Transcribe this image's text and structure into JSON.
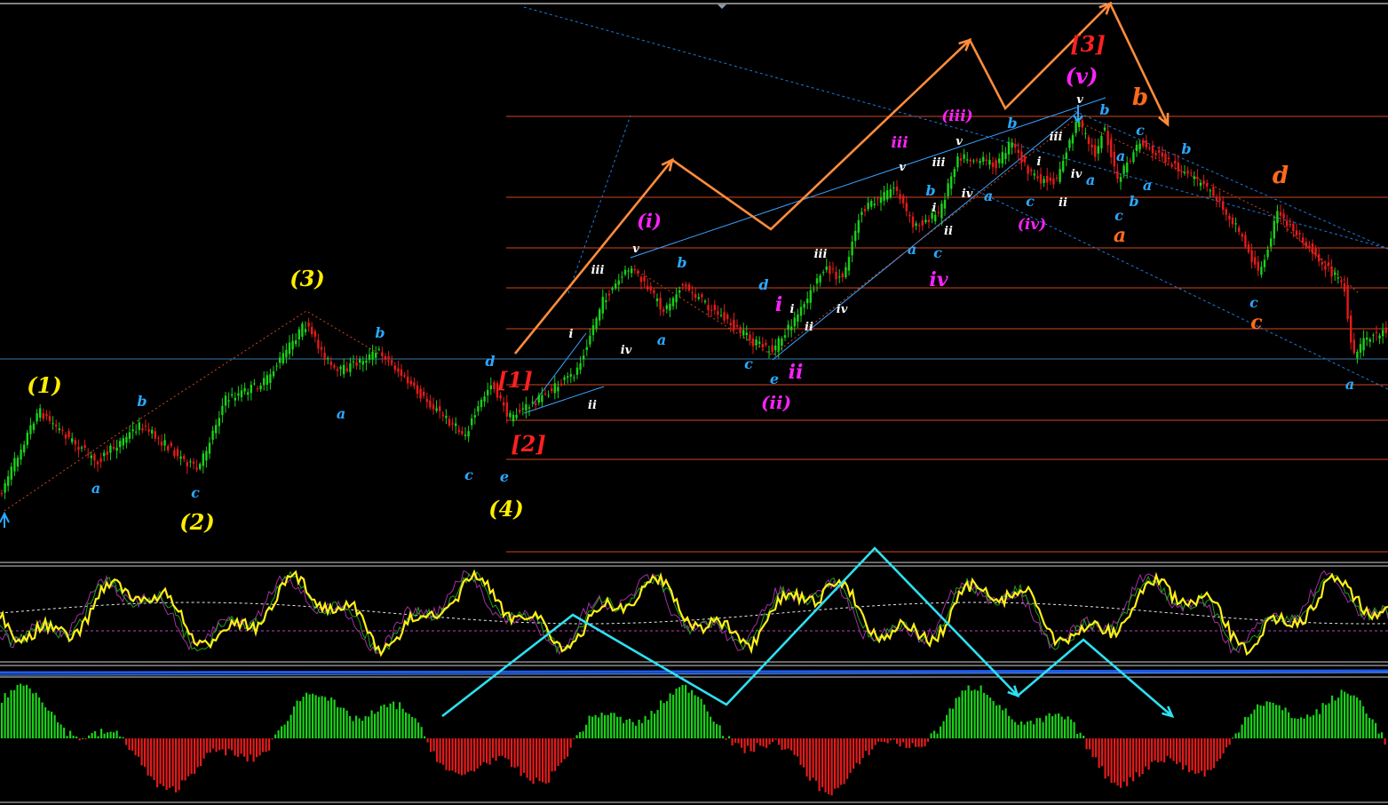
{
  "chart_data": {
    "type": "candlestick",
    "title": "",
    "xlabel": "",
    "ylabel": "",
    "grid": false,
    "indicators": [
      "oscillator",
      "histogram"
    ],
    "colors": {
      "background": "#000000",
      "bull": "#19d219",
      "bear": "#e51a1a",
      "level_line": "#d2461e",
      "trend_line": "#1e78dc",
      "orange_path": "#ff8c3c",
      "cyan_path": "#2ee0f0",
      "oscillator": "#ffef1a",
      "hist_up": "#19d219",
      "hist_down": "#e51a1a"
    },
    "wave_labels": [
      {
        "text": "(1)",
        "color": "#ffee00"
      },
      {
        "text": "(2)",
        "color": "#ffee00"
      },
      {
        "text": "(3)",
        "color": "#ffee00"
      },
      {
        "text": "(4)",
        "color": "#ffee00"
      },
      {
        "text": "a",
        "color": "#2aa8ff"
      },
      {
        "text": "b",
        "color": "#2aa8ff"
      },
      {
        "text": "c",
        "color": "#2aa8ff"
      },
      {
        "text": "a",
        "color": "#2aa8ff"
      },
      {
        "text": "b",
        "color": "#2aa8ff"
      },
      {
        "text": "c",
        "color": "#2aa8ff"
      },
      {
        "text": "d",
        "color": "#2aa8ff"
      },
      {
        "text": "e",
        "color": "#2aa8ff"
      },
      {
        "text": "[1]",
        "color": "#ff2020"
      },
      {
        "text": "[2]",
        "color": "#ff2020"
      },
      {
        "text": "[3]",
        "color": "#ff2020"
      },
      {
        "text": "i",
        "color": "#ffffff"
      },
      {
        "text": "ii",
        "color": "#ffffff"
      },
      {
        "text": "iii",
        "color": "#ffffff"
      },
      {
        "text": "iv",
        "color": "#ffffff"
      },
      {
        "text": "v",
        "color": "#ffffff"
      },
      {
        "text": "(i)",
        "color": "#ff22ff"
      },
      {
        "text": "a",
        "color": "#2aa8ff"
      },
      {
        "text": "b",
        "color": "#2aa8ff"
      },
      {
        "text": "c",
        "color": "#2aa8ff"
      },
      {
        "text": "d",
        "color": "#2aa8ff"
      },
      {
        "text": "e",
        "color": "#2aa8ff"
      },
      {
        "text": "(ii)",
        "color": "#ff22ff"
      },
      {
        "text": "i",
        "color": "#ff22ff"
      },
      {
        "text": "ii",
        "color": "#ff22ff"
      },
      {
        "text": "i",
        "color": "#ffffff"
      },
      {
        "text": "ii",
        "color": "#ffffff"
      },
      {
        "text": "iii",
        "color": "#ffffff"
      },
      {
        "text": "iv",
        "color": "#ffffff"
      },
      {
        "text": "v",
        "color": "#ffffff"
      },
      {
        "text": "iii",
        "color": "#ff22ff"
      },
      {
        "text": "a",
        "color": "#2aa8ff"
      },
      {
        "text": "b",
        "color": "#2aa8ff"
      },
      {
        "text": "c",
        "color": "#2aa8ff"
      },
      {
        "text": "iv",
        "color": "#ff22ff"
      },
      {
        "text": "i",
        "color": "#ffffff"
      },
      {
        "text": "ii",
        "color": "#ffffff"
      },
      {
        "text": "iii",
        "color": "#ffffff"
      },
      {
        "text": "iv",
        "color": "#ffffff"
      },
      {
        "text": "v",
        "color": "#ffffff"
      },
      {
        "text": "(iii)",
        "color": "#ff22ff"
      },
      {
        "text": "a",
        "color": "#2aa8ff"
      },
      {
        "text": "b",
        "color": "#2aa8ff"
      },
      {
        "text": "c",
        "color": "#2aa8ff"
      },
      {
        "text": "(iv)",
        "color": "#ff22ff"
      },
      {
        "text": "i",
        "color": "#ffffff"
      },
      {
        "text": "ii",
        "color": "#ffffff"
      },
      {
        "text": "iii",
        "color": "#ffffff"
      },
      {
        "text": "iv",
        "color": "#ffffff"
      },
      {
        "text": "v",
        "color": "#ffffff"
      },
      {
        "text": "(v)",
        "color": "#ff22ff"
      },
      {
        "text": "a",
        "color": "#2aa8ff"
      },
      {
        "text": "b",
        "color": "#2aa8ff"
      },
      {
        "text": "c",
        "color": "#2aa8ff"
      },
      {
        "text": "a",
        "color": "#ff6a1a"
      },
      {
        "text": "a",
        "color": "#2aa8ff"
      },
      {
        "text": "b",
        "color": "#2aa8ff"
      },
      {
        "text": "c",
        "color": "#2aa8ff"
      },
      {
        "text": "b",
        "color": "#ff6a1a"
      },
      {
        "text": "a",
        "color": "#2aa8ff"
      },
      {
        "text": "b",
        "color": "#2aa8ff"
      },
      {
        "text": "c",
        "color": "#2aa8ff"
      },
      {
        "text": "c",
        "color": "#ff6a1a"
      },
      {
        "text": "d",
        "color": "#ff6a1a"
      },
      {
        "text": "a",
        "color": "#2aa8ff"
      }
    ]
  }
}
